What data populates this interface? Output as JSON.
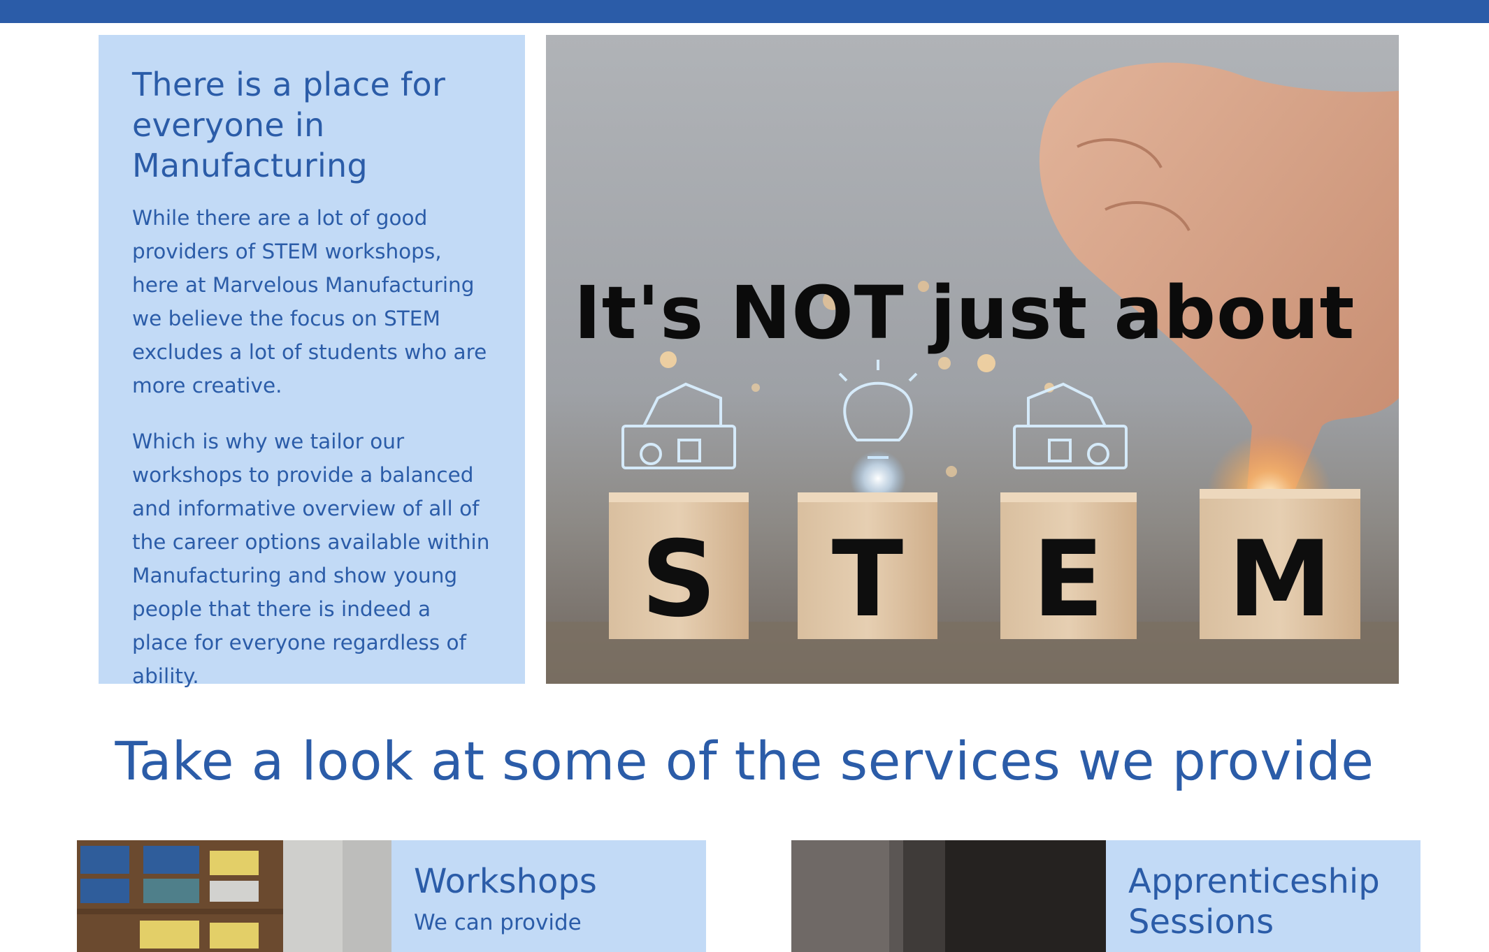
{
  "intro": {
    "heading": "There is a place for everyone in Manufacturing",
    "paragraph_1": "While there are a lot of good providers of STEM workshops, here at Marvelous Manufacturing we believe the focus on STEM excludes a lot of students who are more creative.",
    "paragraph_2": "Which is why we tailor our workshops to provide a balanced and informative overview of all of the career options available within Manufacturing and show young people that there is indeed a place for everyone regardless of ability."
  },
  "hero": {
    "headline": "It's NOT just about",
    "blocks": [
      "S",
      "T",
      "E",
      "M"
    ]
  },
  "services": {
    "heading": "Take a look at some of the services we provide",
    "cards": [
      {
        "title": "Workshops",
        "text": "We can provide"
      },
      {
        "title": "Apprenticeship Sessions",
        "text": ""
      }
    ]
  },
  "colors": {
    "brand_blue": "#2b5ca8",
    "panel_blue": "#c2daf6",
    "background": "#ffffff"
  }
}
